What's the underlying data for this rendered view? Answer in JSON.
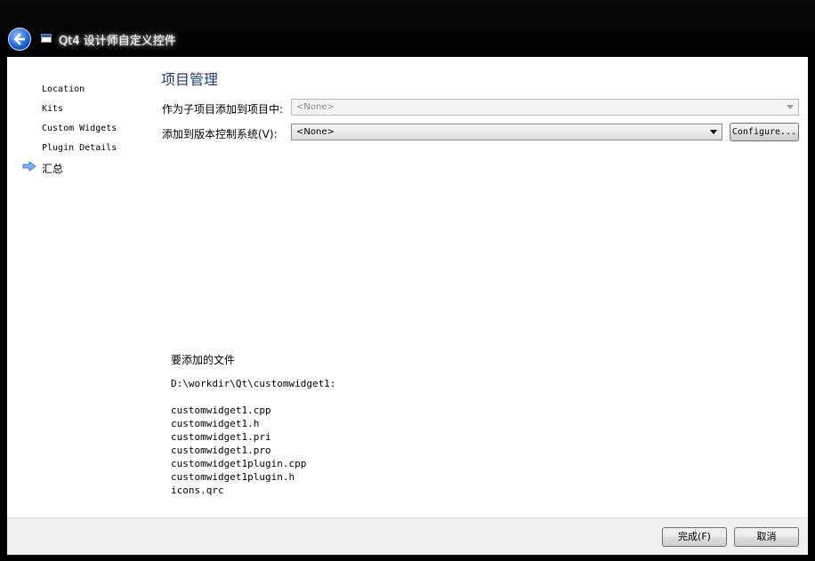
{
  "window": {
    "title": "Qt4 设计师自定义控件"
  },
  "nav": {
    "items": [
      {
        "label": "Location"
      },
      {
        "label": "Kits"
      },
      {
        "label": "Custom Widgets"
      },
      {
        "label": "Plugin Details"
      },
      {
        "label": "汇总"
      }
    ],
    "current_index": 4
  },
  "page": {
    "title": "项目管理",
    "add_to_project_label": "作为子项目添加到项目中:",
    "add_to_project_value": "<None>",
    "vcs_label": "添加到版本控制系统(V):",
    "vcs_value": "<None>",
    "configure_label": "Configure..."
  },
  "files": {
    "heading": "要添加的文件",
    "directory": "D:\\workdir\\Qt\\customwidget1:",
    "list": [
      "customwidget1.cpp",
      "customwidget1.h",
      "customwidget1.pri",
      "customwidget1.pro",
      "customwidget1plugin.cpp",
      "customwidget1plugin.h",
      "icons.qrc"
    ]
  },
  "footer": {
    "finish_label": "完成(F)",
    "cancel_label": "取消"
  },
  "colors": {
    "title_blue": "#1e3a6e",
    "nav_arrow": "#3a7fd5"
  }
}
